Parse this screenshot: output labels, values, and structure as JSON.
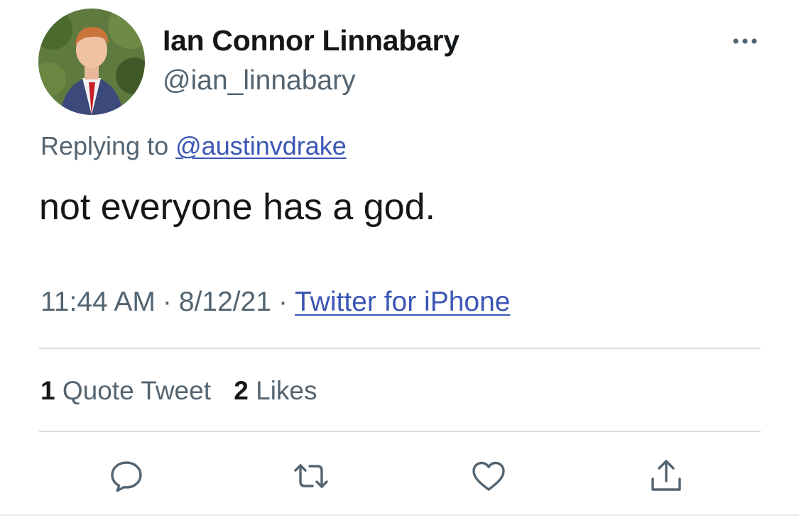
{
  "tweet": {
    "author": {
      "display_name": "Ian Connor Linnabary",
      "handle": "@ian_linnabary",
      "avatar_icon": "profile-photo"
    },
    "reply": {
      "prefix": "Replying to",
      "to_handle": "@austinvdrake"
    },
    "text": "not everyone has a god.",
    "meta": {
      "time": "11:44 AM",
      "separator": "·",
      "date": "8/12/21",
      "source": "Twitter for iPhone"
    },
    "stats": {
      "quote_count": "1",
      "quote_label": "Quote Tweet",
      "like_count": "2",
      "like_label": "Likes"
    },
    "actions": [
      {
        "icon": "reply-icon"
      },
      {
        "icon": "retweet-icon"
      },
      {
        "icon": "like-icon"
      },
      {
        "icon": "share-icon"
      }
    ],
    "colors": {
      "text": "#14171a",
      "secondary": "#536471",
      "link": "#3b56b5",
      "divider": "#d9dde1"
    }
  }
}
